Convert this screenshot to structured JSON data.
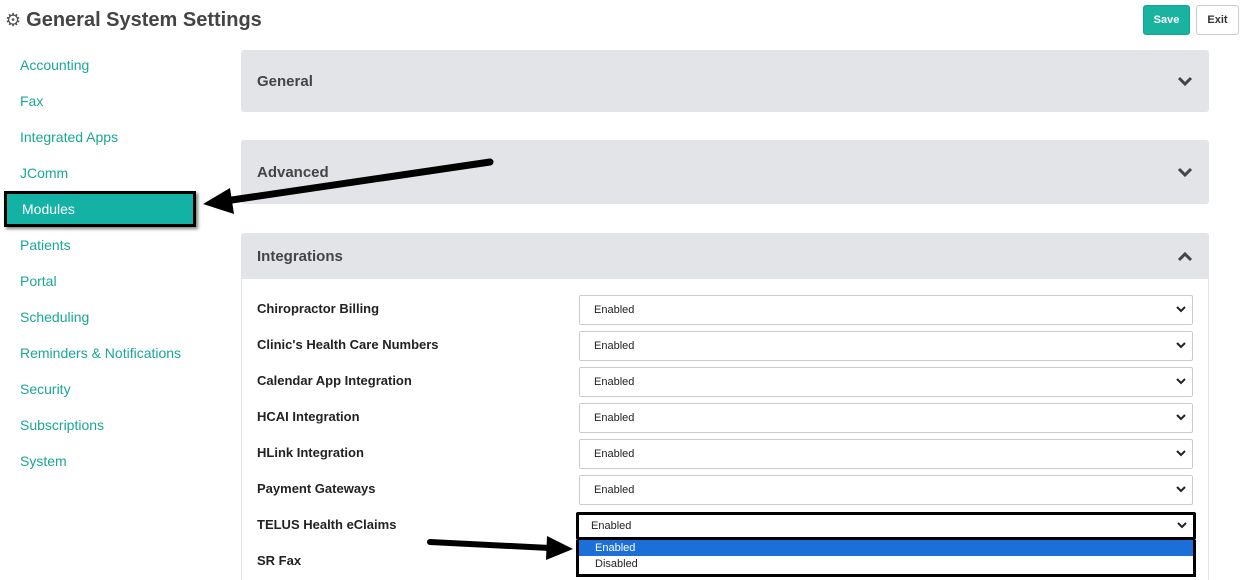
{
  "header": {
    "title": "General System Settings",
    "gear_icon": "gear-icon",
    "save_label": "Save",
    "exit_label": "Exit"
  },
  "colors": {
    "accent": "#1ab39f",
    "active_nav": "#14b2a5",
    "panel_header": "#e2e4e8",
    "dropdown_highlight": "#1b6fd6"
  },
  "sidebar": {
    "items": [
      {
        "label": "Accounting"
      },
      {
        "label": "Fax"
      },
      {
        "label": "Integrated Apps"
      },
      {
        "label": "JComm"
      },
      {
        "label": "Modules",
        "active": true
      },
      {
        "label": "Patients"
      },
      {
        "label": "Portal"
      },
      {
        "label": "Scheduling"
      },
      {
        "label": "Reminders & Notifications"
      },
      {
        "label": "Security"
      },
      {
        "label": "Subscriptions"
      },
      {
        "label": "System"
      }
    ]
  },
  "panels": {
    "general": {
      "label": "General",
      "expanded": false,
      "icon": "chevron-down-icon"
    },
    "advanced": {
      "label": "Advanced",
      "expanded": false,
      "icon": "chevron-down-icon"
    },
    "integrations": {
      "label": "Integrations",
      "expanded": true,
      "icon": "chevron-up-icon"
    }
  },
  "integrations": {
    "rows": [
      {
        "label": "Chiropractor Billing",
        "value": "Enabled"
      },
      {
        "label": "Clinic's Health Care Numbers",
        "value": "Enabled"
      },
      {
        "label": "Calendar App Integration",
        "value": "Enabled"
      },
      {
        "label": "HCAI Integration",
        "value": "Enabled"
      },
      {
        "label": "HLink Integration",
        "value": "Enabled"
      },
      {
        "label": "Payment Gateways",
        "value": "Enabled"
      },
      {
        "label": "TELUS Health eClaims",
        "value": "Enabled",
        "open": true
      },
      {
        "label": "SR Fax"
      }
    ],
    "dropdown_options": [
      {
        "label": "Enabled",
        "highlighted": true
      },
      {
        "label": "Disabled",
        "highlighted": false
      }
    ]
  }
}
